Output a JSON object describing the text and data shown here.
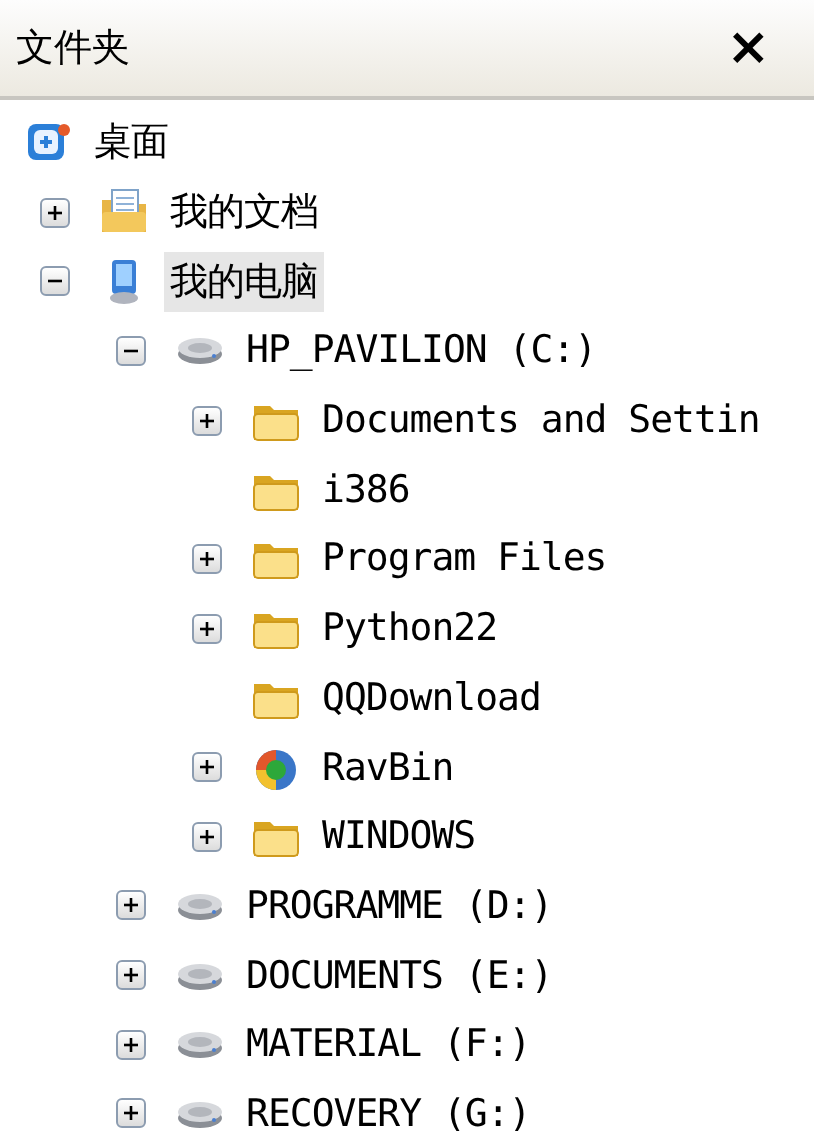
{
  "panel": {
    "title": "文件夹",
    "close": "×"
  },
  "tree": [
    {
      "label": "桌面",
      "kind": "desktop",
      "selected": false,
      "children": [
        {
          "label": "我的文档",
          "kind": "documents",
          "expanded": false,
          "selected": false
        },
        {
          "label": "我的电脑",
          "kind": "computer",
          "expanded": true,
          "selected": true,
          "children": [
            {
              "label": "HP_PAVILION (C:)",
              "kind": "drive",
              "expanded": true,
              "selected": false,
              "children": [
                {
                  "label": "Documents and Settin",
                  "kind": "folder",
                  "expanded": false,
                  "selected": false
                },
                {
                  "label": "i386",
                  "kind": "folder",
                  "selected": false
                },
                {
                  "label": "Program Files",
                  "kind": "folder",
                  "expanded": false,
                  "selected": false
                },
                {
                  "label": "Python22",
                  "kind": "folder",
                  "expanded": false,
                  "selected": false
                },
                {
                  "label": "QQDownload",
                  "kind": "folder",
                  "selected": false
                },
                {
                  "label": "RavBin",
                  "kind": "program",
                  "expanded": false,
                  "selected": false
                },
                {
                  "label": "WINDOWS",
                  "kind": "folder",
                  "expanded": false,
                  "selected": false
                }
              ]
            },
            {
              "label": "PROGRAMME (D:)",
              "kind": "drive",
              "expanded": false,
              "selected": false
            },
            {
              "label": "DOCUMENTS (E:)",
              "kind": "drive",
              "expanded": false,
              "selected": false
            },
            {
              "label": "MATERIAL (F:)",
              "kind": "drive",
              "expanded": false,
              "selected": false
            },
            {
              "label": "RECOVERY (G:)",
              "kind": "drive",
              "expanded": false,
              "selected": false
            }
          ]
        }
      ]
    }
  ]
}
